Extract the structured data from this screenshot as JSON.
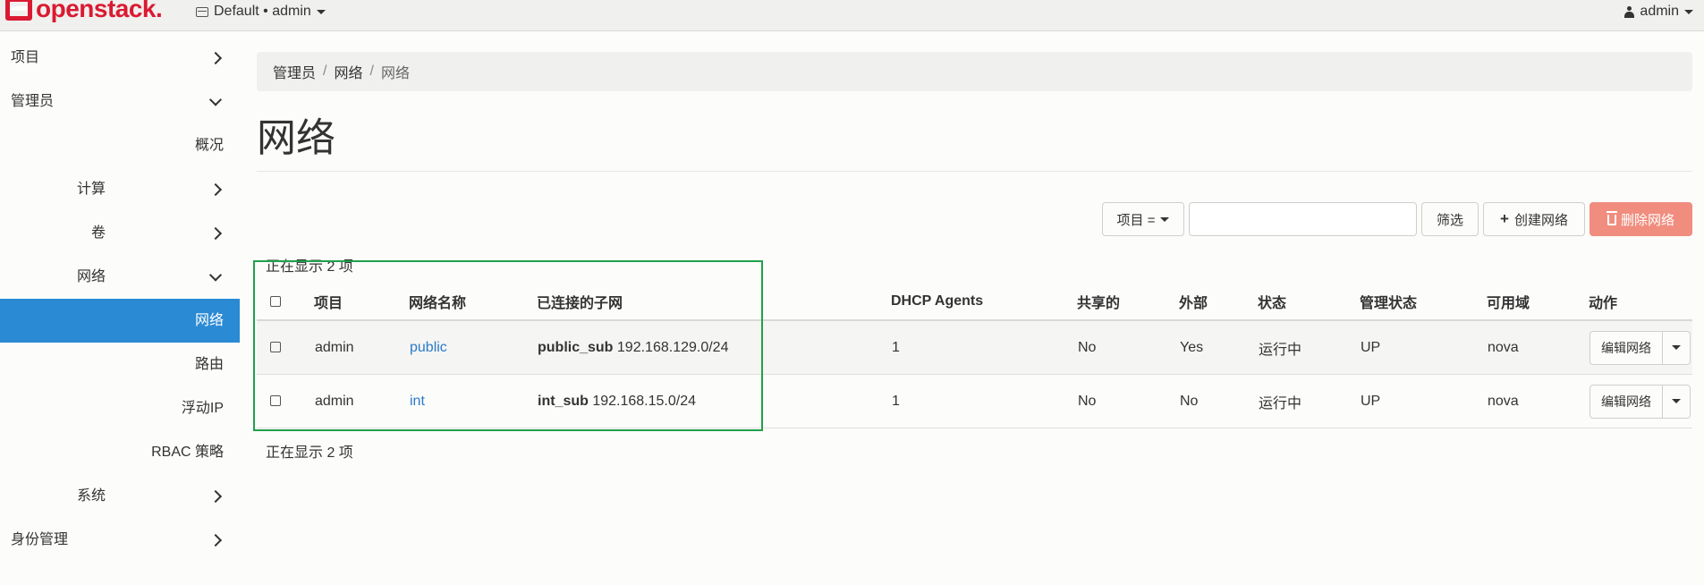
{
  "brand": {
    "name": "openstack.",
    "color": "#da1a32"
  },
  "topbar": {
    "project_label": "Default • admin",
    "user_label": "admin"
  },
  "sidebar": {
    "items": [
      {
        "label": "项目",
        "level": 1,
        "chevron": "right"
      },
      {
        "label": "管理员",
        "level": 1,
        "chevron": "down"
      },
      {
        "label": "概况",
        "level": 3
      },
      {
        "label": "计算",
        "level": 2,
        "chevron": "right"
      },
      {
        "label": "卷",
        "level": 2,
        "chevron": "right"
      },
      {
        "label": "网络",
        "level": 2,
        "chevron": "down"
      },
      {
        "label": "网络",
        "level": 3,
        "active": true
      },
      {
        "label": "路由",
        "level": 3
      },
      {
        "label": "浮动IP",
        "level": 3
      },
      {
        "label": "RBAC 策略",
        "level": 3
      },
      {
        "label": "系统",
        "level": 2,
        "chevron": "right"
      },
      {
        "label": "身份管理",
        "level": 1,
        "chevron": "right"
      }
    ],
    "active_color": "#2a8ad4"
  },
  "breadcrumb": [
    "管理员",
    "网络",
    "网络"
  ],
  "page_title": "网络",
  "toolbar": {
    "filter_field": "项目 =",
    "filter_value": "",
    "filter_button": "筛选",
    "create_button": "创建网络",
    "delete_button": "删除网络",
    "delete_color": "#f08d7e"
  },
  "count_text": "正在显示 2 项",
  "table": {
    "headers": [
      "项目",
      "网络名称",
      "已连接的子网",
      "DHCP Agents",
      "共享的",
      "外部",
      "状态",
      "管理状态",
      "可用域",
      "动作"
    ],
    "rows": [
      {
        "project": "admin",
        "name": "public",
        "subnet_name": "public_sub",
        "subnet_cidr": "192.168.129.0/24",
        "dhcp": "1",
        "shared": "No",
        "external": "Yes",
        "status": "运行中",
        "admin_state": "UP",
        "zone": "nova",
        "action": "编辑网络"
      },
      {
        "project": "admin",
        "name": "int",
        "subnet_name": "int_sub",
        "subnet_cidr": "192.168.15.0/24",
        "dhcp": "1",
        "shared": "No",
        "external": "No",
        "status": "运行中",
        "admin_state": "UP",
        "zone": "nova",
        "action": "编辑网络"
      }
    ]
  },
  "highlight_color": "#1fa14a"
}
